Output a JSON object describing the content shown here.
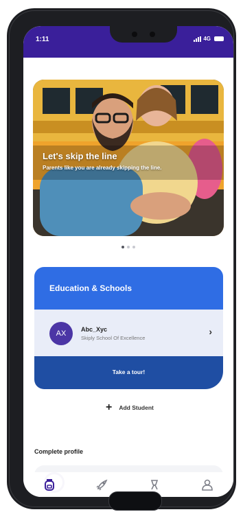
{
  "status_bar": {
    "time": "1:11",
    "network": "4G"
  },
  "hero": {
    "title": "Let's skip the line",
    "subtitle": "Parents like you are already skipping the line."
  },
  "carousel": {
    "count": 3,
    "active": 0
  },
  "education": {
    "title": "Education & Schools",
    "student": {
      "initials": "AX",
      "name": "Abc_Xyc",
      "school": "Skiply School Of Excellence"
    },
    "tour_label": "Take a tour!"
  },
  "add_student_label": "Add Student",
  "complete_profile": {
    "title": "Complete profile"
  },
  "tabs": [
    {
      "icon": "school-bag-icon",
      "active": true
    },
    {
      "icon": "rocket-icon",
      "active": false
    },
    {
      "icon": "rewards-icon",
      "active": false
    },
    {
      "icon": "profile-icon",
      "active": false
    }
  ],
  "colors": {
    "brand_purple": "#3a1f9a",
    "education_blue": "#2f6de4",
    "tour_blue": "#1f4ea3",
    "row_bg": "#e9edf8"
  }
}
